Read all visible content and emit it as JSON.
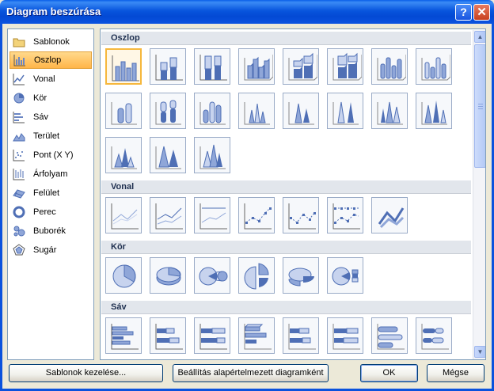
{
  "window": {
    "title": "Diagram beszúrása",
    "help_label": "?",
    "close_label": "✕"
  },
  "categories": [
    {
      "label": "Sablonok",
      "icon": "folder-icon"
    },
    {
      "label": "Oszlop",
      "icon": "column-chart-icon",
      "selected": true
    },
    {
      "label": "Vonal",
      "icon": "line-chart-icon"
    },
    {
      "label": "Kör",
      "icon": "pie-chart-icon"
    },
    {
      "label": "Sáv",
      "icon": "bar-chart-icon"
    },
    {
      "label": "Terület",
      "icon": "area-chart-icon"
    },
    {
      "label": "Pont (X Y)",
      "icon": "scatter-chart-icon"
    },
    {
      "label": "Árfolyam",
      "icon": "stock-chart-icon"
    },
    {
      "label": "Felület",
      "icon": "surface-chart-icon"
    },
    {
      "label": "Perec",
      "icon": "doughnut-chart-icon"
    },
    {
      "label": "Buborék",
      "icon": "bubble-chart-icon"
    },
    {
      "label": "Sugár",
      "icon": "radar-chart-icon"
    }
  ],
  "sections": {
    "oszlop": "Oszlop",
    "vonal": "Vonal",
    "kor": "Kör",
    "sav": "Sáv"
  },
  "buttons": {
    "manage_templates": "Sablonok kezelése...",
    "set_default": "Beállítás alapértelmezett diagramként",
    "ok": "OK",
    "cancel": "Mégse"
  },
  "colors": {
    "accent": "#4F6FB5",
    "selection": "#F6B73C",
    "title_bar": "#0A52DD"
  }
}
